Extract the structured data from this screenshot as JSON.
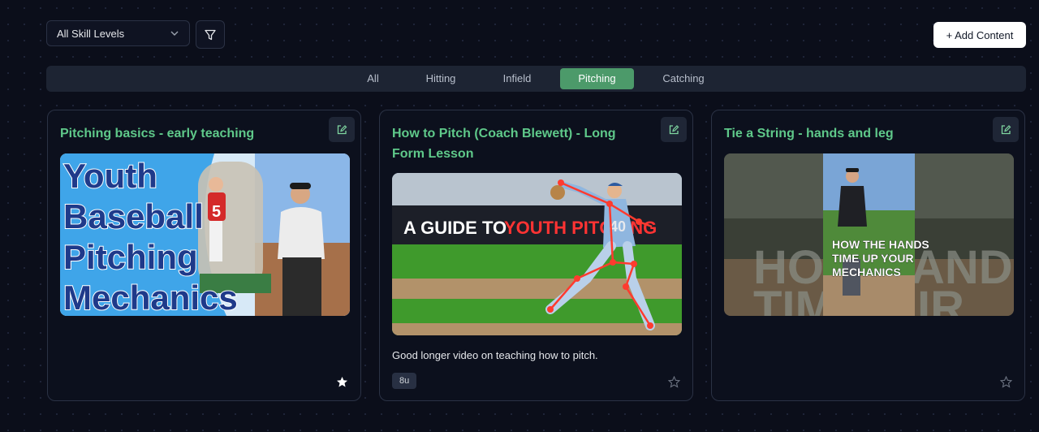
{
  "toolbar": {
    "skill_select": "All Skill Levels",
    "add_content_label": "+ Add Content"
  },
  "tabs": [
    {
      "label": "All",
      "active": false
    },
    {
      "label": "Hitting",
      "active": false
    },
    {
      "label": "Infield",
      "active": false
    },
    {
      "label": "Pitching",
      "active": true
    },
    {
      "label": "Catching",
      "active": false
    }
  ],
  "cards": [
    {
      "title": "Pitching basics - early teaching",
      "thumbnail_text": [
        "Youth",
        "Baseball",
        "Pitching",
        "Mechanics"
      ],
      "jersey_number": "5",
      "description": "",
      "tag": "",
      "starred": true
    },
    {
      "title": "How to Pitch (Coach Blewett) - Long Form Lesson",
      "thumbnail_text_a": "A GUIDE TO",
      "thumbnail_text_b": "YOUTH PITCHING",
      "jersey_number": "40",
      "description": "Good longer video on teaching how to pitch.",
      "tag": "8u",
      "starred": false
    },
    {
      "title": "Tie a String - hands and leg",
      "thumbnail_text": [
        "HOW THE HANDS",
        "TIME UP YOUR",
        "MECHANICS"
      ],
      "background_text": [
        "HOW",
        "TIME",
        "ANDS",
        "IR"
      ],
      "description": "",
      "tag": "",
      "starred": false
    }
  ],
  "colors": {
    "background": "#0b0e1a",
    "accent": "#5fc98a",
    "active_tab": "#4c9a6a",
    "card_border": "#2b3245"
  }
}
